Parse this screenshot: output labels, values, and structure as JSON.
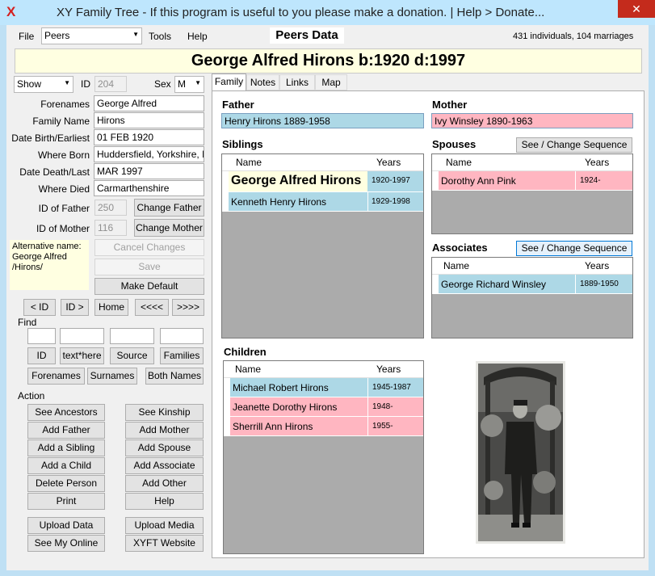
{
  "window": {
    "title": "XY Family Tree - If this program is useful to you please make a donation. | Help > Donate...",
    "close": "✕"
  },
  "menu": {
    "file": "File",
    "peers_select": "Peers",
    "tools": "Tools",
    "help": "Help",
    "view_title": "Peers Data",
    "stats": "431 individuals, 104 marriages"
  },
  "banner": "George Alfred Hirons  b:1920 d:1997",
  "person": {
    "show_select": "Show",
    "id_label": "ID",
    "id_value": "204",
    "sex_label": "Sex",
    "sex_value": "M",
    "forenames_label": "Forenames",
    "forenames": "George Alfred",
    "family_label": "Family Name",
    "family": "Hirons",
    "birth_label": "Date Birth/Earliest",
    "birth": "01 FEB 1920",
    "born_label": "Where Born",
    "born": "Huddersfield, Yorkshire, England",
    "death_label": "Date Death/Last",
    "death": "MAR 1997",
    "died_label": "Where Died",
    "died": "Carmarthenshire",
    "father_label": "ID of Father",
    "father_id": "250",
    "change_father": "Change Father",
    "mother_label": "ID of Mother",
    "mother_id": "116",
    "change_mother": "Change Mother",
    "alt_name": "Alternative name:\nGeorge Alfred\n/Hirons/",
    "cancel": "Cancel Changes",
    "save": "Save",
    "make_default": "Make Default"
  },
  "nav": {
    "prev_id": "< ID",
    "next_id": "ID >",
    "home": "Home",
    "back": "<<<<",
    "fwd": ">>>>"
  },
  "find": {
    "label": "Find",
    "id": "ID",
    "text": "text*here",
    "source": "Source",
    "families": "Families",
    "forenames": "Forenames",
    "surnames": "Surnames",
    "both": "Both Names"
  },
  "action": {
    "label": "Action",
    "see_ancestors": "See Ancestors",
    "see_kinship": "See Kinship",
    "add_father": "Add Father",
    "add_mother": "Add Mother",
    "add_sibling": "Add a Sibling",
    "add_spouse": "Add Spouse",
    "add_child": "Add a Child",
    "add_associate": "Add Associate",
    "delete_person": "Delete Person",
    "add_other": "Add Other",
    "print": "Print",
    "help": "Help",
    "upload_data": "Upload Data",
    "upload_media": "Upload Media",
    "see_online": "See My Online",
    "website": "XYFT Website"
  },
  "tabs": [
    "Family",
    "Notes",
    "Links",
    "Map"
  ],
  "family": {
    "father_title": "Father",
    "father": "Henry Hirons 1889-1958",
    "mother_title": "Mother",
    "mother": "Ivy Winsley 1890-1963",
    "siblings_title": "Siblings",
    "spouses_title": "Spouses",
    "associates_title": "Associates",
    "children_title": "Children",
    "see_change": "See / Change Sequence",
    "col_name": "Name",
    "col_years": "Years",
    "siblings": [
      {
        "name": "George Alfred Hirons",
        "years": "1920-1997"
      },
      {
        "name": "Kenneth Henry Hirons",
        "years": "1929-1998"
      }
    ],
    "spouses": [
      {
        "name": "Dorothy Ann Pink",
        "years": "1924-"
      }
    ],
    "associates": [
      {
        "name": "George Richard Winsley",
        "years": "1889-1950"
      }
    ],
    "children": [
      {
        "name": "Michael Robert Hirons",
        "years": "1945-1987"
      },
      {
        "name": "Jeanette Dorothy Hirons",
        "years": "1948-"
      },
      {
        "name": "Sherrill Ann Hirons",
        "years": "1955-"
      }
    ]
  },
  "colors": {
    "male": "#add8e6",
    "female": "#ffb6c1",
    "current": "#ffffe1",
    "title_bar": "#bee6fd"
  }
}
